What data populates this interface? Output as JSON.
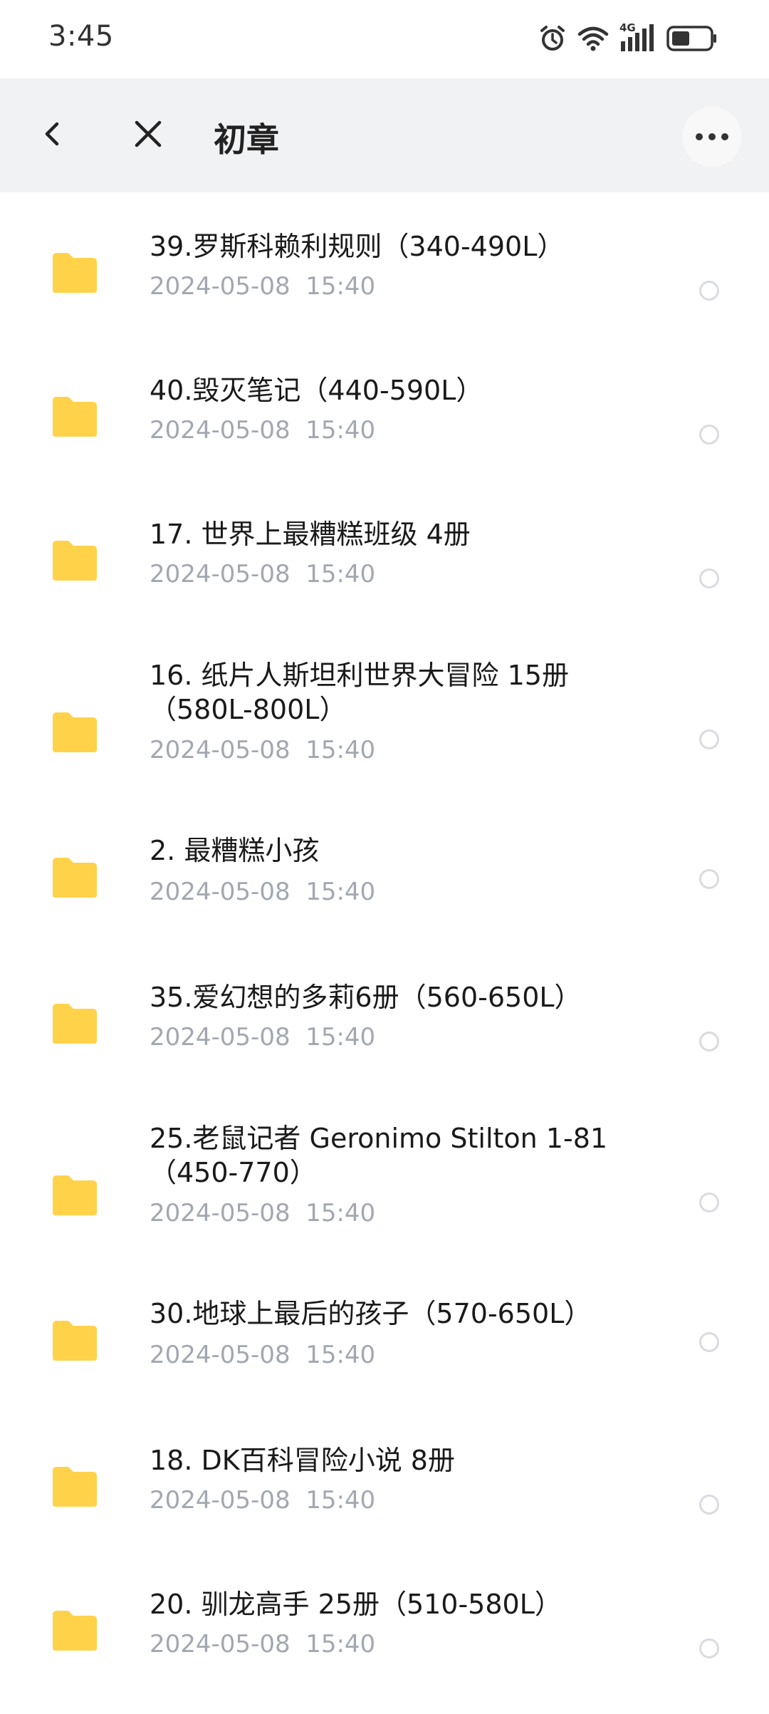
{
  "status_bar": {
    "time": "3:45",
    "network_label": "4G",
    "icons": [
      "alarm-icon",
      "wifi-icon",
      "signal-icon",
      "battery-icon"
    ]
  },
  "header": {
    "title": "初章",
    "back_icon": "chevron-left-icon",
    "close_icon": "close-icon",
    "more_icon": "more-horizontal-icon"
  },
  "colors": {
    "folder": "#ffd24a",
    "header_bg": "#f1f2f4",
    "date_text": "#a3a7b0"
  },
  "items": [
    {
      "name": "39.罗斯科赖利规则（340-490L）",
      "date": "2024-05-08  15:40"
    },
    {
      "name": "40.毁灭笔记（440-590L）",
      "date": "2024-05-08  15:40"
    },
    {
      "name": "17. 世界上最糟糕班级 4册",
      "date": "2024-05-08  15:40"
    },
    {
      "name": "16. 纸片人斯坦利世界大冒险 15册（580L-800L）",
      "date": "2024-05-08  15:40"
    },
    {
      "name": "2. 最糟糕小孩",
      "date": "2024-05-08  15:40"
    },
    {
      "name": "35.爱幻想的多莉6册（560-650L）",
      "date": "2024-05-08  15:40"
    },
    {
      "name": "25.老鼠记者 Geronimo Stilton 1-81（450-770）",
      "date": "2024-05-08  15:40"
    },
    {
      "name": "30.地球上最后的孩子（570-650L）",
      "date": "2024-05-08  15:40"
    },
    {
      "name": "18. DK百科冒险小说 8册",
      "date": "2024-05-08  15:40"
    },
    {
      "name": "20. 驯龙高手 25册（510-580L）",
      "date": "2024-05-08  15:40"
    }
  ]
}
